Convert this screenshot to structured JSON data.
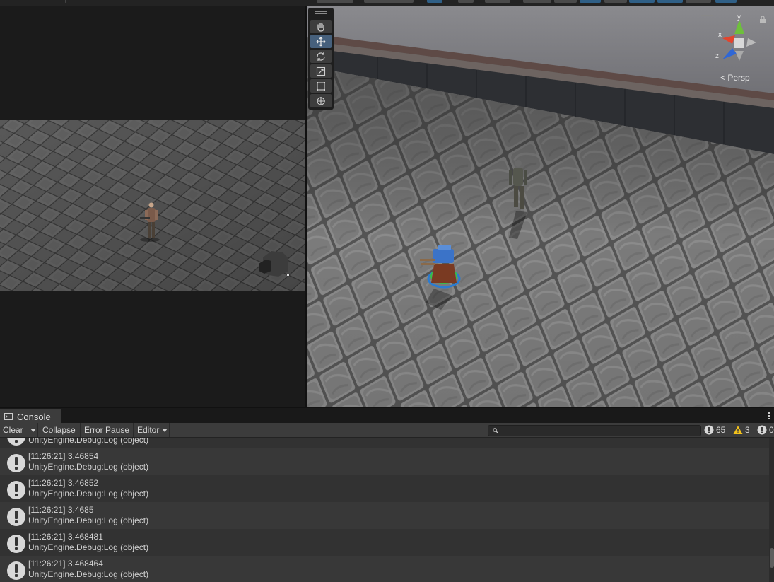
{
  "game_view": {
    "panel": "game-view"
  },
  "scene_view": {
    "projection_label": "Persp",
    "gizmo_axes": {
      "x": "x",
      "y": "y",
      "z": "z"
    },
    "tools": [
      "hand-tool",
      "move-tool",
      "rotate-tool",
      "scale-tool",
      "rect-tool",
      "transform-tool"
    ],
    "active_tool": "move-tool"
  },
  "console": {
    "tab_label": "Console",
    "toolbar": {
      "clear_label": "Clear",
      "collapse_label": "Collapse",
      "error_pause_label": "Error Pause",
      "editor_label": "Editor",
      "search_placeholder": ""
    },
    "counts": {
      "info": "65",
      "warnings": "3",
      "errors": "0"
    },
    "partial_row": {
      "line2": "UnityEngine.Debug:Log (object)"
    },
    "logs": [
      {
        "line1": "[11:26:21] 3.46854",
        "line2": "UnityEngine.Debug:Log (object)"
      },
      {
        "line1": "[11:26:21] 3.46852",
        "line2": "UnityEngine.Debug:Log (object)"
      },
      {
        "line1": "[11:26:21] 3.4685",
        "line2": "UnityEngine.Debug:Log (object)"
      },
      {
        "line1": "[11:26:21] 3.468481",
        "line2": "UnityEngine.Debug:Log (object)"
      },
      {
        "line1": "[11:26:21] 3.468464",
        "line2": "UnityEngine.Debug:Log (object)"
      }
    ]
  },
  "colors": {
    "panel_dark": "#1b1b1b",
    "toolbar": "#3c3c3c",
    "row_even": "#383838",
    "row_odd": "#323232",
    "active_tool": "#46607c",
    "warning": "#f3c21b",
    "info_icon": "#d8d8d8"
  }
}
